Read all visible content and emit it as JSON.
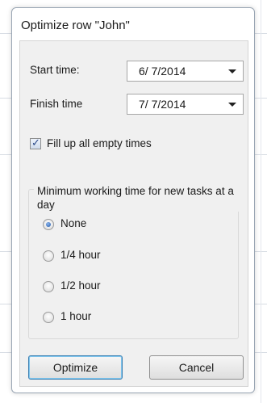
{
  "dialog": {
    "title": "Optimize row \"John\""
  },
  "start_time": {
    "label": "Start time:",
    "value": "6/  7/2014"
  },
  "finish_time": {
    "label": "Finish time",
    "value": "7/  7/2014"
  },
  "fill_empty": {
    "label": "Fill up all empty times",
    "checked": true
  },
  "min_working_time": {
    "legend": "Minimum working time for new tasks at a day",
    "options": [
      {
        "label": "None",
        "selected": true
      },
      {
        "label": "1/4 hour",
        "selected": false
      },
      {
        "label": "1/2 hour",
        "selected": false
      },
      {
        "label": "1 hour",
        "selected": false
      }
    ]
  },
  "buttons": {
    "optimize": "Optimize",
    "cancel": "Cancel"
  },
  "icons": {
    "dropdown": "chevron-down-icon",
    "check": "checkmark-icon"
  }
}
